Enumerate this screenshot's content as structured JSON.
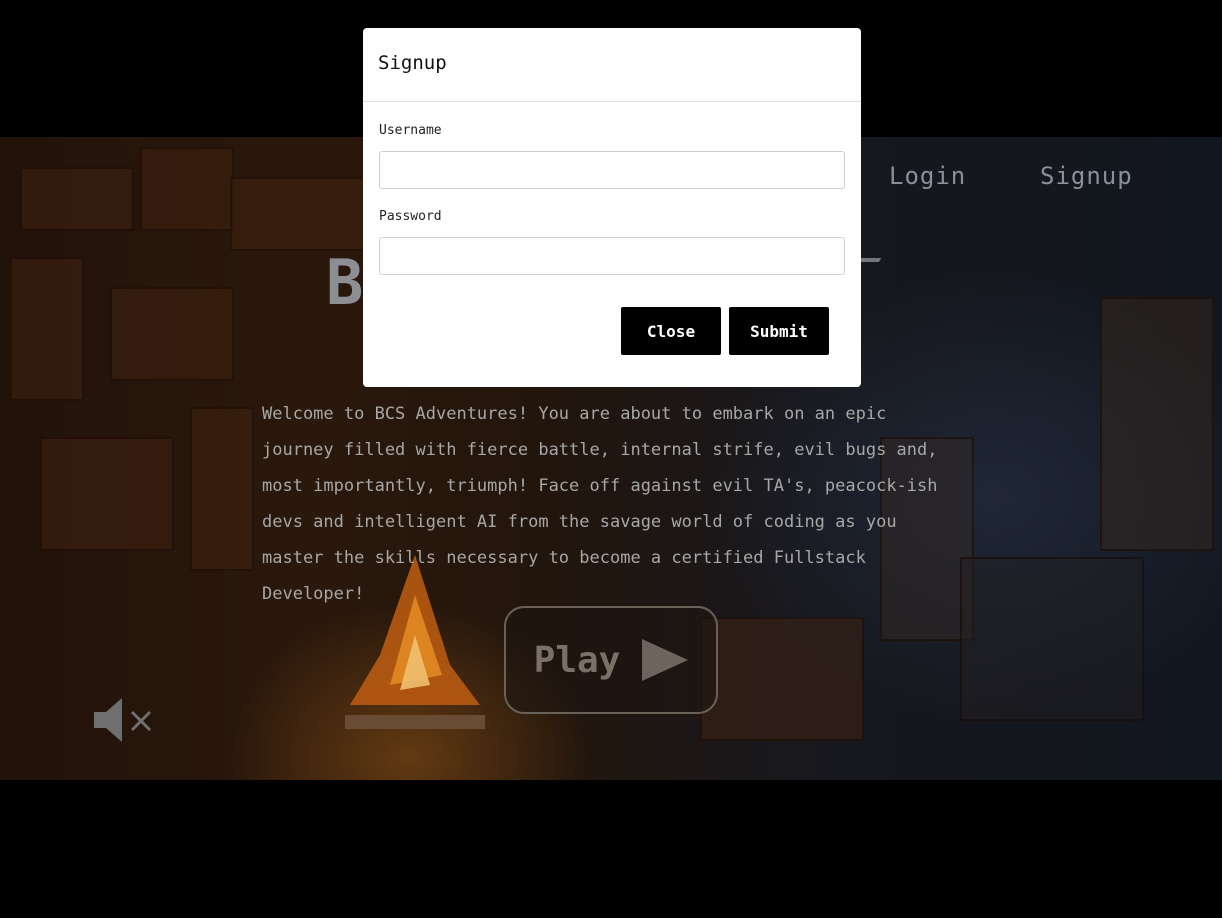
{
  "nav": {
    "login_label": "Login",
    "signup_label": "Signup"
  },
  "hero": {
    "title_visible": "B",
    "intro": "Welcome to BCS Adventures! You are about to embark on an epic journey filled with fierce battle, internal strife, evil bugs and, most importantly, triumph! Face off against evil TA's, peacock-ish devs and intelligent AI from the savage world of coding as you master the skills necessary to become a certified Fullstack Developer!",
    "play_label": "Play"
  },
  "modal": {
    "title": "Signup",
    "username_label": "Username",
    "username_value": "",
    "password_label": "Password",
    "password_value": "",
    "close_label": "Close",
    "submit_label": "Submit"
  },
  "icons": {
    "mute": "volume-mute-icon",
    "play": "play-triangle-icon"
  },
  "colors": {
    "modal_bg": "#ffffff",
    "button_bg": "#000000",
    "page_bg": "#000000"
  }
}
